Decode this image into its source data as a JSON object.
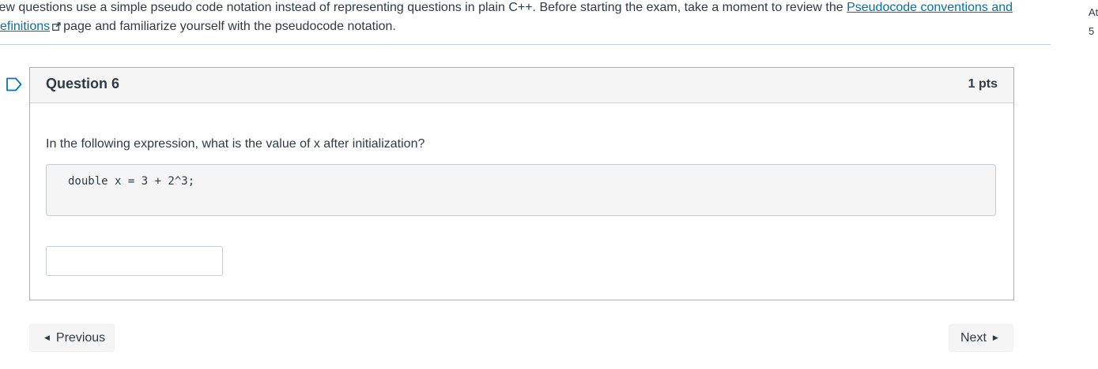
{
  "intro": {
    "line1_text": "few questions use a simple pseudo code notation instead of representing questions in plain C++. Before starting the exam, take a moment to review the ",
    "link_part1": "Pseudocode conventions and",
    "link_part2": "efinitions",
    "line2_text": "page and familiarize yourself with the pseudocode notation."
  },
  "side_info": {
    "line1": "At",
    "line2": "5"
  },
  "question": {
    "title": "Question 6",
    "points": "1 pts",
    "prompt": "In the following expression, what is the value of x after initialization?",
    "code": "double x = 3 + 2^3;",
    "answer_value": ""
  },
  "navigation": {
    "previous_label": "Previous",
    "next_label": "Next"
  },
  "colors": {
    "link": "#0770a3",
    "text": "#2d3b45",
    "flag": "#0374b5",
    "header_bg": "#f5f5f5"
  }
}
